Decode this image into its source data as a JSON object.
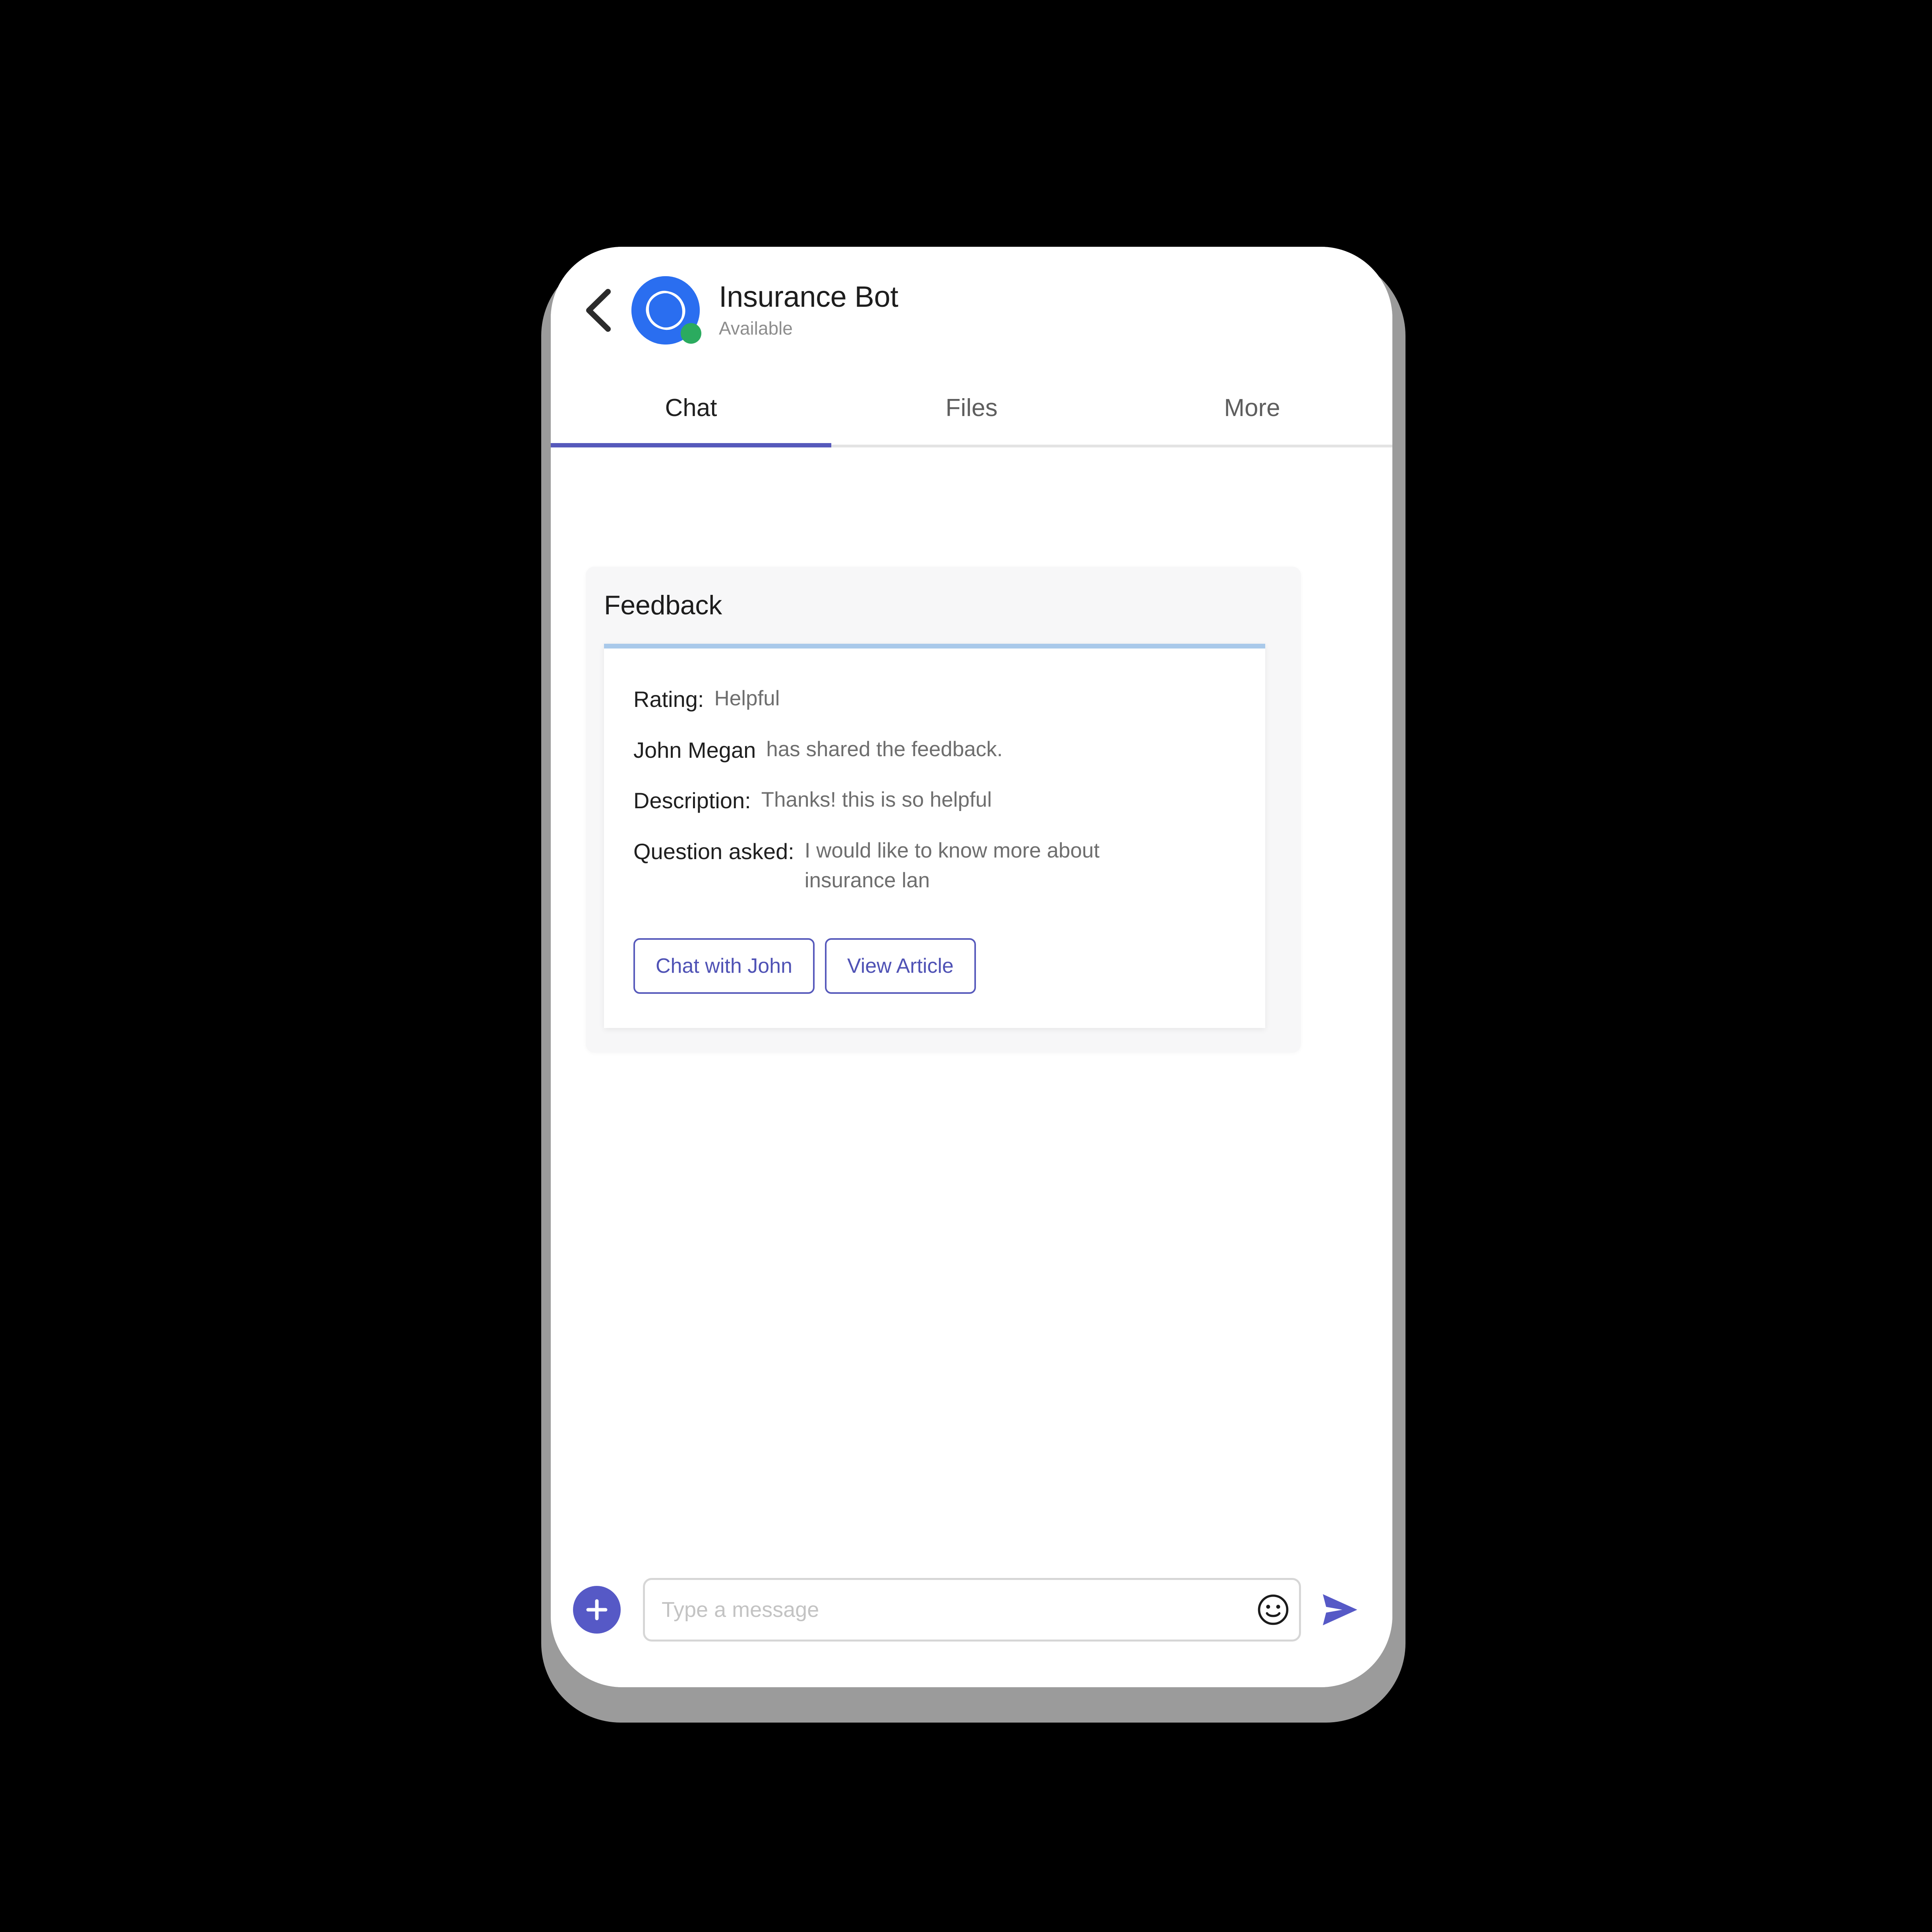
{
  "header": {
    "back_icon": "chevron-left-icon",
    "avatar_icon": "bot-avatar-icon",
    "presence_icon": "presence-available-dot",
    "bot_name": "Insurance Bot",
    "status": "Available",
    "avatar_color": "#2a6ef0",
    "presence_color": "#2bab5f"
  },
  "tabs": {
    "items": [
      {
        "label": "Chat",
        "active": true
      },
      {
        "label": "Files",
        "active": false
      },
      {
        "label": "More",
        "active": false
      }
    ],
    "active_indicator_color": "#5659bb"
  },
  "feedback_card": {
    "title": "Feedback",
    "accent_color": "#a9c9ea",
    "rows": [
      {
        "label": "Rating:",
        "value": "Helpful"
      },
      {
        "label": "Description:",
        "value": "Thanks! this is so helpful"
      },
      {
        "label": "Question asked:",
        "value": "I would like to know more about insurance lan"
      }
    ],
    "sharer_name": "John Megan",
    "sharer_text": "has shared the feedback.",
    "actions": [
      {
        "label": "Chat with John"
      },
      {
        "label": "View Article"
      }
    ],
    "action_color": "#4f52b5"
  },
  "composer": {
    "add_icon": "plus-icon",
    "emoji_icon": "smiley-face-icon",
    "send_icon": "send-paper-plane-icon",
    "input_value": "",
    "placeholder": "Type a message",
    "accent_color": "#5659c6"
  }
}
